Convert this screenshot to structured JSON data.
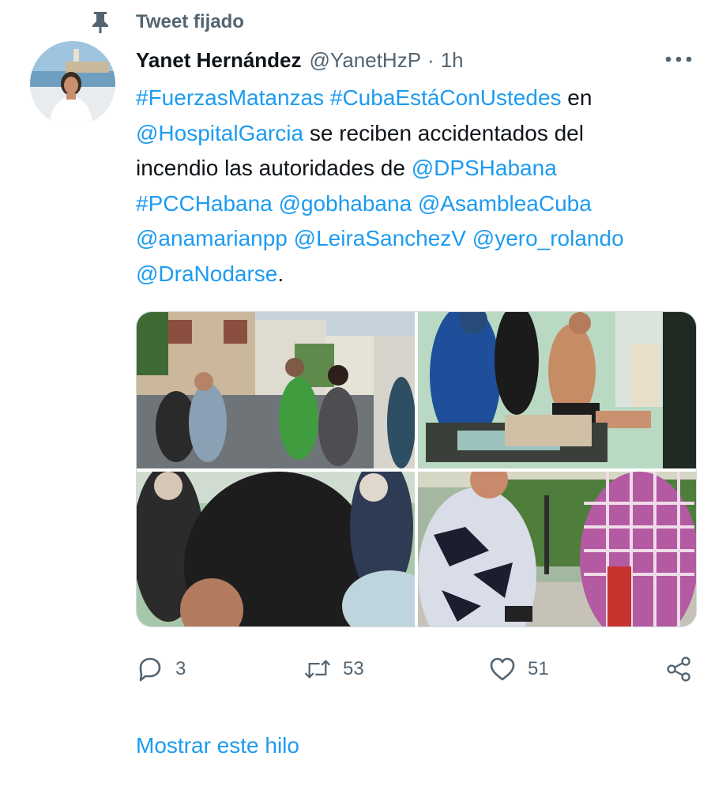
{
  "pinned": {
    "label": "Tweet fijado",
    "icon": "pin-icon"
  },
  "author": {
    "name": "Yanet Hernández",
    "handle": "@YanetHzP",
    "separator": "·",
    "time": "1h"
  },
  "tweet": {
    "lines": [
      [
        {
          "t": "#FuerzasMatanzas",
          "link": true
        },
        {
          "t": " ",
          "link": false
        },
        {
          "t": "#CubaEstáConUstedes",
          "link": true
        },
        {
          "t": " en",
          "link": false
        }
      ],
      [
        {
          "t": "@HospitalGarcia",
          "link": true
        },
        {
          "t": " se reciben accidentados del",
          "link": false
        }
      ],
      [
        {
          "t": "incendio las autoridades de ",
          "link": false
        },
        {
          "t": "@DPSHabana",
          "link": true
        }
      ],
      [
        {
          "t": "#PCCHabana",
          "link": true
        },
        {
          "t": " ",
          "link": false
        },
        {
          "t": "@gobhabana",
          "link": true
        },
        {
          "t": " ",
          "link": false
        },
        {
          "t": "@AsambleaCuba",
          "link": true
        }
      ],
      [
        {
          "t": "@anamarianpp",
          "link": true
        },
        {
          "t": " ",
          "link": false
        },
        {
          "t": "@LeiraSanchezV",
          "link": true
        },
        {
          "t": " ",
          "link": false
        },
        {
          "t": "@yero_rolando",
          "link": true
        }
      ],
      [
        {
          "t": "@DraNodarse",
          "link": true
        },
        {
          "t": ".",
          "link": false
        }
      ]
    ]
  },
  "actions": {
    "reply": {
      "count": "3",
      "icon": "reply-bubble-icon"
    },
    "retweet": {
      "count": "53",
      "icon": "retweet-icon"
    },
    "like": {
      "count": "51",
      "icon": "heart-icon"
    },
    "share": {
      "icon": "share-icon"
    }
  },
  "show_thread": "Mostrar este hilo",
  "colors": {
    "link": "#1d9bf0",
    "secondary_text": "#536471",
    "primary_text": "#0f1419",
    "border": "#cfd9de"
  }
}
